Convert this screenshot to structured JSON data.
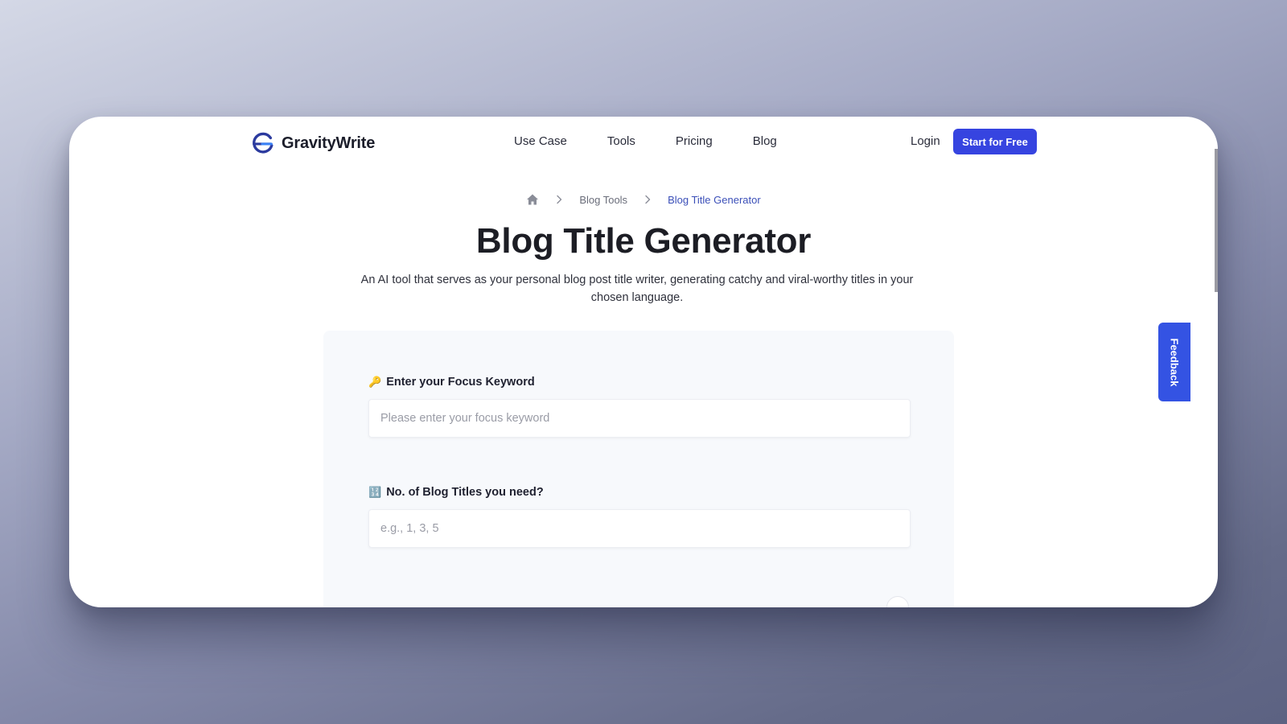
{
  "brand": {
    "name": "GravityWrite",
    "logo_icon": "gravitywrite-logo-icon",
    "accent": "#3644e0"
  },
  "nav": {
    "items": [
      "Use Case",
      "Tools",
      "Pricing",
      "Blog"
    ]
  },
  "auth": {
    "login_label": "Login",
    "start_label": "Start for Free"
  },
  "breadcrumb": {
    "home_icon": "home-icon",
    "separator_icon": "chevron-right-icon",
    "items": [
      "Blog Tools",
      "Blog Title Generator"
    ]
  },
  "hero": {
    "title": "Blog Title Generator",
    "subtitle": "An AI tool that serves as your personal blog post title writer, generating catchy and viral-worthy titles in your chosen language."
  },
  "form": {
    "keyword": {
      "emoji": "🔑",
      "label": "Enter your Focus Keyword",
      "placeholder": "Please enter your focus keyword",
      "value": ""
    },
    "count": {
      "emoji": "🔢",
      "label": "No. of Blog Titles you need?",
      "placeholder": "e.g., 1, 3, 5",
      "value": ""
    }
  },
  "feedback": {
    "label": "Feedback",
    "color": "#3453e3"
  }
}
